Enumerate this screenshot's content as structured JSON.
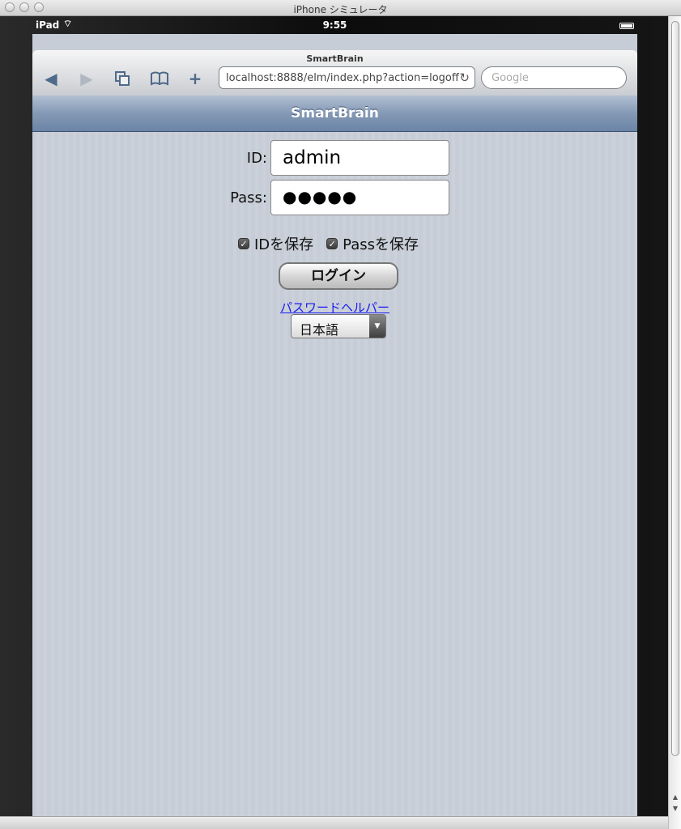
{
  "window": {
    "title": "iPhone シミュレータ"
  },
  "status_bar": {
    "carrier": "iPad",
    "wifi_icon": "▾",
    "time": "9:55"
  },
  "safari": {
    "page_title": "SmartBrain",
    "url": "localhost:8888/elm/index.php?action=logoff",
    "search_placeholder": "Google",
    "back_glyph": "◀",
    "forward_glyph": "▶",
    "pages_glyph": "⧉",
    "bookmarks_glyph": "📖",
    "add_glyph": "+",
    "reload_glyph": "↻"
  },
  "navbar": {
    "title": "SmartBrain"
  },
  "login_form": {
    "id_label": "ID:",
    "id_value": "admin",
    "pass_label": "Pass:",
    "pass_value": "●●●●●",
    "save_id_label": "IDを保存",
    "save_pass_label": "Passを保存",
    "save_id_checked": true,
    "save_pass_checked": true,
    "login_button": "ログイン",
    "password_helper_link": "パスワードヘルパー",
    "language_selected": "日本語"
  }
}
